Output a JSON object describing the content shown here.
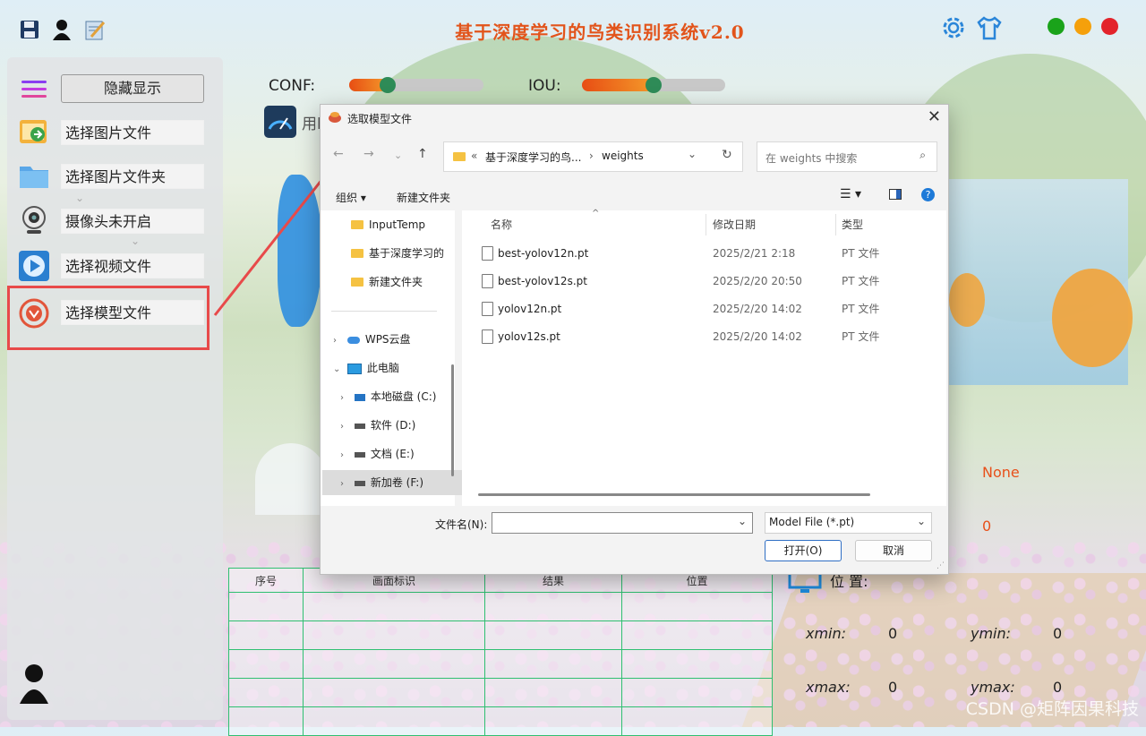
{
  "app": {
    "title": "基于深度学习的鸟类识别系统v2.0",
    "top_icons": [
      "save-icon",
      "user-icon",
      "notepad-icon"
    ],
    "right_icons": [
      "gear-icon",
      "shirt-icon"
    ],
    "window_dots": {
      "green": "#1aa31a",
      "orange": "#f5a00b",
      "red": "#e3232b"
    }
  },
  "sidebar": {
    "hide_button": "隐藏显示",
    "items": [
      {
        "label": "选择图片文件",
        "icon": "image-file-icon"
      },
      {
        "label": "选择图片文件夹",
        "icon": "folder-icon"
      },
      {
        "label": "摄像头未开启",
        "icon": "webcam-icon"
      },
      {
        "label": "选择视频文件",
        "icon": "video-play-icon"
      },
      {
        "label": "选择模型文件",
        "icon": "model-icon"
      }
    ]
  },
  "controls": {
    "conf_label": "CONF:",
    "conf_value": 0.25,
    "iou_label": "IOU:",
    "iou_value": 0.5,
    "partial_label": "用l"
  },
  "table": {
    "headers": [
      "序号",
      "画面标识",
      "结果",
      "位置"
    ],
    "rows": 5
  },
  "info": {
    "none_value": "None",
    "zero_value": "0",
    "position_label": "位 置:",
    "xmin_label": "xmin:",
    "xmin": "0",
    "ymin_label": "ymin:",
    "ymin": "0",
    "xmax_label": "xmax:",
    "xmax": "0",
    "ymax_label": "ymax:",
    "ymax": "0"
  },
  "dialog": {
    "title": "选取模型文件",
    "breadcrumb": [
      "«",
      "基于深度学习的鸟...",
      "›",
      "weights"
    ],
    "search_placeholder": "在 weights 中搜索",
    "organize": "组织 ▾",
    "new_folder": "新建文件夹",
    "nav": [
      {
        "label": "InputTemp",
        "type": "folder"
      },
      {
        "label": "基于深度学习的",
        "type": "folder"
      },
      {
        "label": "新建文件夹",
        "type": "folder"
      },
      {
        "label": "WPS云盘",
        "type": "cloud"
      },
      {
        "label": "此电脑",
        "type": "pc"
      },
      {
        "label": "本地磁盘 (C:)",
        "type": "drive"
      },
      {
        "label": "软件 (D:)",
        "type": "drive"
      },
      {
        "label": "文档 (E:)",
        "type": "drive"
      },
      {
        "label": "新加卷 (F:)",
        "type": "drive"
      }
    ],
    "columns": [
      "名称",
      "修改日期",
      "类型"
    ],
    "files": [
      {
        "name": "best-yolov12n.pt",
        "date": "2025/2/21 2:18",
        "type": "PT 文件"
      },
      {
        "name": "best-yolov12s.pt",
        "date": "2025/2/20 20:50",
        "type": "PT 文件"
      },
      {
        "name": "yolov12n.pt",
        "date": "2025/2/20 14:02",
        "type": "PT 文件"
      },
      {
        "name": "yolov12s.pt",
        "date": "2025/2/20 14:02",
        "type": "PT 文件"
      }
    ],
    "filename_label": "文件名(N):",
    "filename_value": "",
    "filter": "Model File (*.pt)",
    "open": "打开(O)",
    "cancel": "取消"
  },
  "watermark": "CSDN @矩阵因果科技"
}
